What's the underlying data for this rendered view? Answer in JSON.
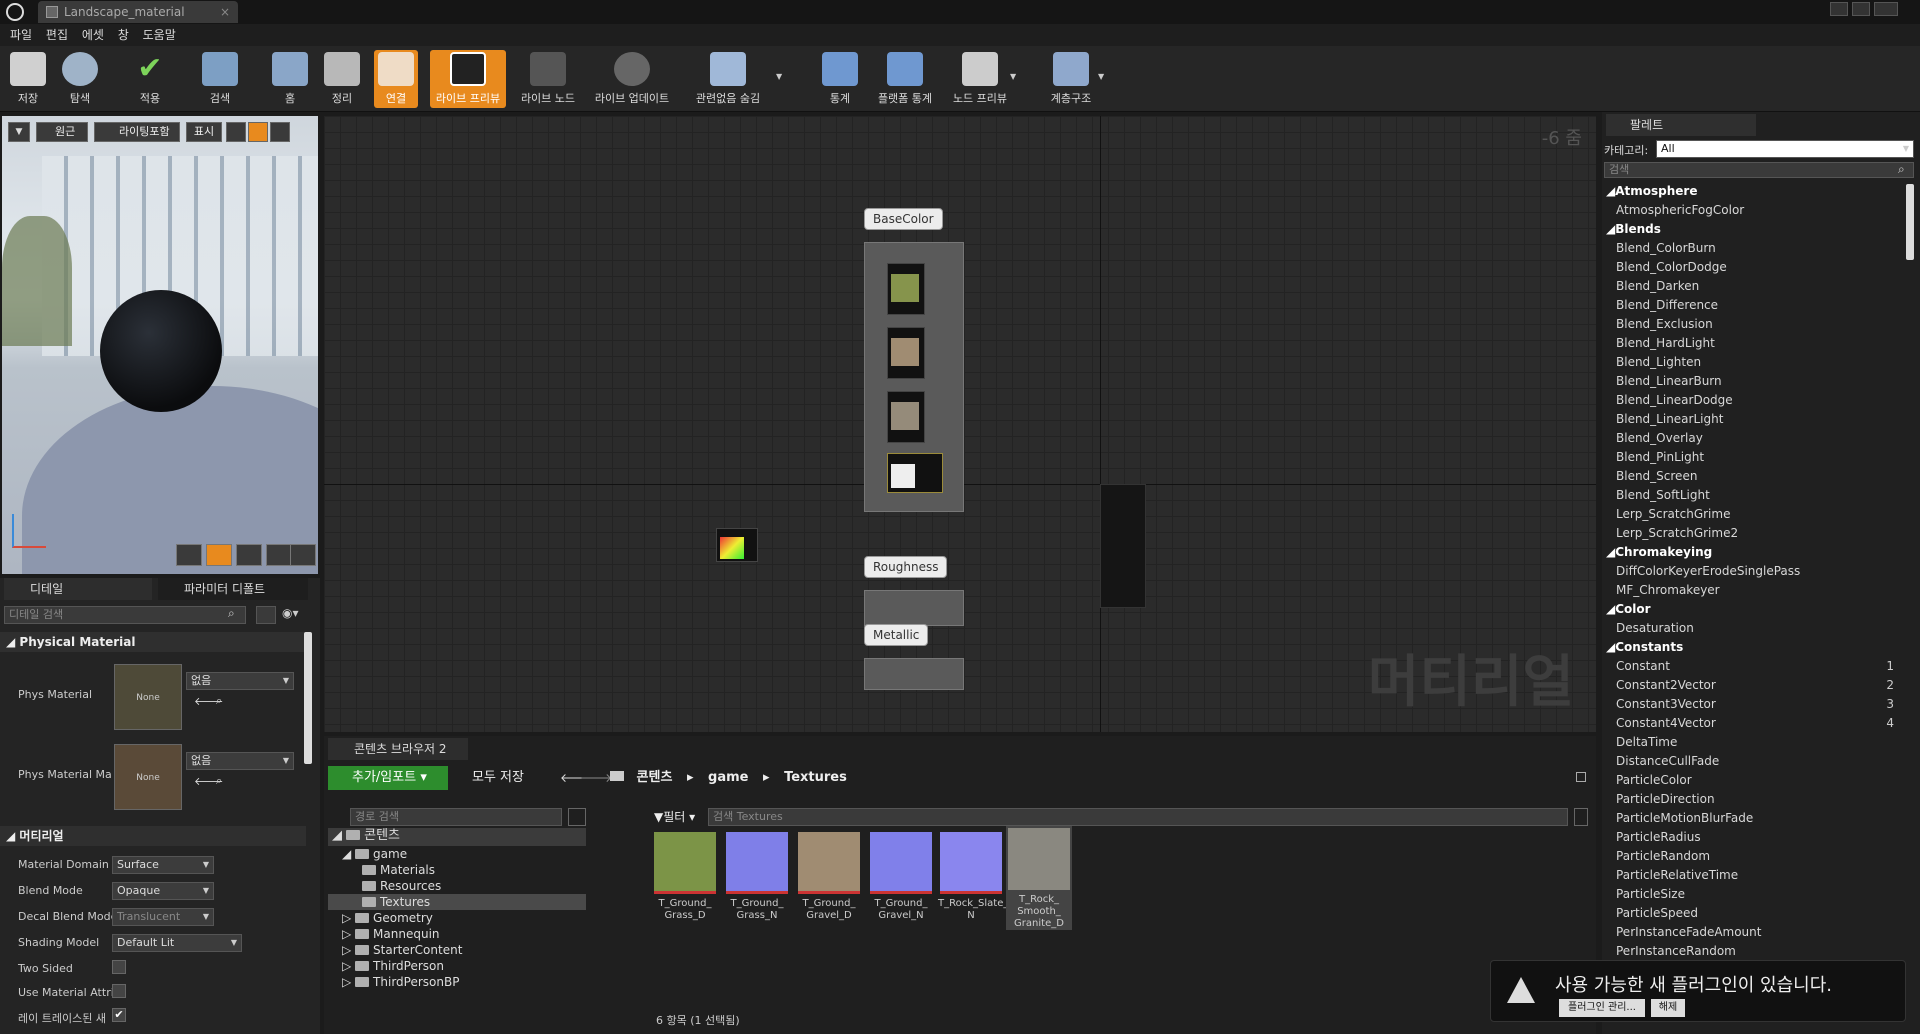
{
  "window": {
    "tab_title": "Landscape_material"
  },
  "menu": [
    "파일",
    "편집",
    "에셋",
    "창",
    "도움말"
  ],
  "toolbar": [
    {
      "label": "저장",
      "icon": "save-icon"
    },
    {
      "label": "탐색",
      "icon": "browse-icon"
    },
    {
      "label": "적용",
      "icon": "apply-icon"
    },
    {
      "label": "검색",
      "icon": "search-icon"
    },
    {
      "label": "홈",
      "icon": "home-icon"
    },
    {
      "label": "정리",
      "icon": "clean-icon"
    },
    {
      "label": "연결",
      "icon": "connectors-icon"
    },
    {
      "label": "라이브 프리뷰",
      "icon": "live-preview-icon"
    },
    {
      "label": "라이브 노드",
      "icon": "live-nodes-icon"
    },
    {
      "label": "라이브 업데이트",
      "icon": "live-update-icon"
    },
    {
      "label": "관련없음 숨김",
      "icon": "hide-unrelated-icon"
    },
    {
      "label": "통계",
      "icon": "stats-icon"
    },
    {
      "label": "플랫폼 통계",
      "icon": "platform-stats-icon"
    },
    {
      "label": "노드 프리뷰",
      "icon": "node-preview-icon"
    },
    {
      "label": "계층구조",
      "icon": "hierarchy-icon"
    }
  ],
  "viewport": {
    "perspective": "원근",
    "lighting": "라이팅포함",
    "show": "표시"
  },
  "details": {
    "tab_details": "디테일",
    "tab_params": "파라미터 디폴트",
    "search_placeholder": "디테일 검색",
    "section_physical": "Physical Material",
    "phys_material_label": "Phys Material",
    "phys_material_map_label": "Phys Material Ma",
    "none": "None",
    "none_select": "없음",
    "section_material": "머티리얼",
    "material_domain_label": "Material Domain",
    "material_domain": "Surface",
    "blend_mode_label": "Blend Mode",
    "blend_mode": "Opaque",
    "decal_blend_label": "Decal Blend Mode",
    "decal_blend": "Translucent",
    "shading_model_label": "Shading Model",
    "shading_model": "Default Lit",
    "two_sided_label": "Two Sided",
    "use_attr_label": "Use Material Attri",
    "ray_label": "레이 트레이스된 새"
  },
  "graph": {
    "zoom": "-6 줌",
    "watermark": "머티리얼",
    "labels": {
      "basecolor": "BaseColor",
      "roughness": "Roughness",
      "metallic": "Metallic"
    }
  },
  "content_browser": {
    "tab": "콘텐츠 브라우저 2",
    "add_import": "추가/임포트",
    "save_all": "모두 저장",
    "breadcrumb": [
      "콘텐츠",
      "game",
      "Textures"
    ],
    "path_search_placeholder": "경로 검색",
    "filter": "필터",
    "asset_search_placeholder": "검색 Textures",
    "tree": [
      {
        "name": "콘텐츠",
        "level": 0
      },
      {
        "name": "game",
        "level": 1
      },
      {
        "name": "Materials",
        "level": 2
      },
      {
        "name": "Resources",
        "level": 2
      },
      {
        "name": "Textures",
        "level": 2,
        "selected": true
      },
      {
        "name": "Geometry",
        "level": 1
      },
      {
        "name": "Mannequin",
        "level": 1
      },
      {
        "name": "StarterContent",
        "level": 1
      },
      {
        "name": "ThirdPerson",
        "level": 1
      },
      {
        "name": "ThirdPersonBP",
        "level": 1
      }
    ],
    "assets": [
      {
        "name": "T_Ground_ Grass_D",
        "color": "#7c9447"
      },
      {
        "name": "T_Ground_ Grass_N",
        "color": "#7f7fe8"
      },
      {
        "name": "T_Ground_ Gravel_D",
        "color": "#a08c72"
      },
      {
        "name": "T_Ground_ Gravel_N",
        "color": "#8080ea"
      },
      {
        "name": "T_Rock_Slate_ N",
        "color": "#8a86ee"
      },
      {
        "name": "T_Rock_ Smooth_ Granite_D",
        "color": "#8a8880"
      }
    ],
    "status": "6 항목 (1 선택됨)"
  },
  "palette": {
    "tab": "팔레트",
    "category_label": "카테고리:",
    "category_value": "All",
    "search_placeholder": "검색",
    "groups": [
      {
        "name": "Atmosphere",
        "items": [
          {
            "name": "AtmosphericFogColor"
          }
        ]
      },
      {
        "name": "Blends",
        "items": [
          {
            "name": "Blend_ColorBurn"
          },
          {
            "name": "Blend_ColorDodge"
          },
          {
            "name": "Blend_Darken"
          },
          {
            "name": "Blend_Difference"
          },
          {
            "name": "Blend_Exclusion"
          },
          {
            "name": "Blend_HardLight"
          },
          {
            "name": "Blend_Lighten"
          },
          {
            "name": "Blend_LinearBurn"
          },
          {
            "name": "Blend_LinearDodge"
          },
          {
            "name": "Blend_LinearLight"
          },
          {
            "name": "Blend_Overlay"
          },
          {
            "name": "Blend_PinLight"
          },
          {
            "name": "Blend_Screen"
          },
          {
            "name": "Blend_SoftLight"
          },
          {
            "name": "Lerp_ScratchGrime"
          },
          {
            "name": "Lerp_ScratchGrime2"
          }
        ]
      },
      {
        "name": "Chromakeying",
        "items": [
          {
            "name": "DiffColorKeyerErodeSinglePass"
          },
          {
            "name": "MF_Chromakeyer"
          }
        ]
      },
      {
        "name": "Color",
        "items": [
          {
            "name": "Desaturation"
          }
        ]
      },
      {
        "name": "Constants",
        "items": [
          {
            "name": "Constant",
            "key": "1"
          },
          {
            "name": "Constant2Vector",
            "key": "2"
          },
          {
            "name": "Constant3Vector",
            "key": "3"
          },
          {
            "name": "Constant4Vector",
            "key": "4"
          },
          {
            "name": "DeltaTime"
          },
          {
            "name": "DistanceCullFade"
          },
          {
            "name": "ParticleColor"
          },
          {
            "name": "ParticleDirection"
          },
          {
            "name": "ParticleMotionBlurFade"
          },
          {
            "name": "ParticleRadius"
          },
          {
            "name": "ParticleRandom"
          },
          {
            "name": "ParticleRelativeTime"
          },
          {
            "name": "ParticleSize"
          },
          {
            "name": "ParticleSpeed"
          },
          {
            "name": "PerInstanceFadeAmount"
          },
          {
            "name": "PerInstanceRandom"
          }
        ]
      }
    ]
  },
  "notification": {
    "text": "사용 가능한 새 플러그인이 있습니다.",
    "manage": "플러그인 관리...",
    "dismiss": "해제"
  }
}
